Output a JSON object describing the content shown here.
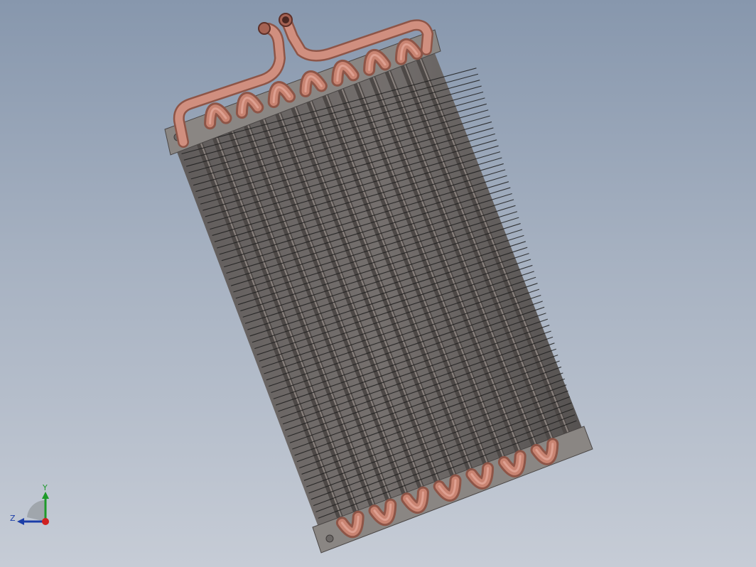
{
  "viewport": {
    "background_top": "#8797ad",
    "background_bottom": "#c6ccd6"
  },
  "model": {
    "tube_color": "#c98472",
    "tube_highlight": "#e4a898",
    "tube_shadow": "#8e5547",
    "fin_color": "#1e1e1e",
    "fin_panel_color": "#6a6461",
    "end_plate_color": "#8a8683",
    "tube_count": 15,
    "fin_count": 60
  },
  "triad": {
    "y_label": "Y",
    "z_label": "Z",
    "y_color": "#1e9a2a",
    "z_color": "#1c3ea8",
    "x_color": "#d02020"
  }
}
